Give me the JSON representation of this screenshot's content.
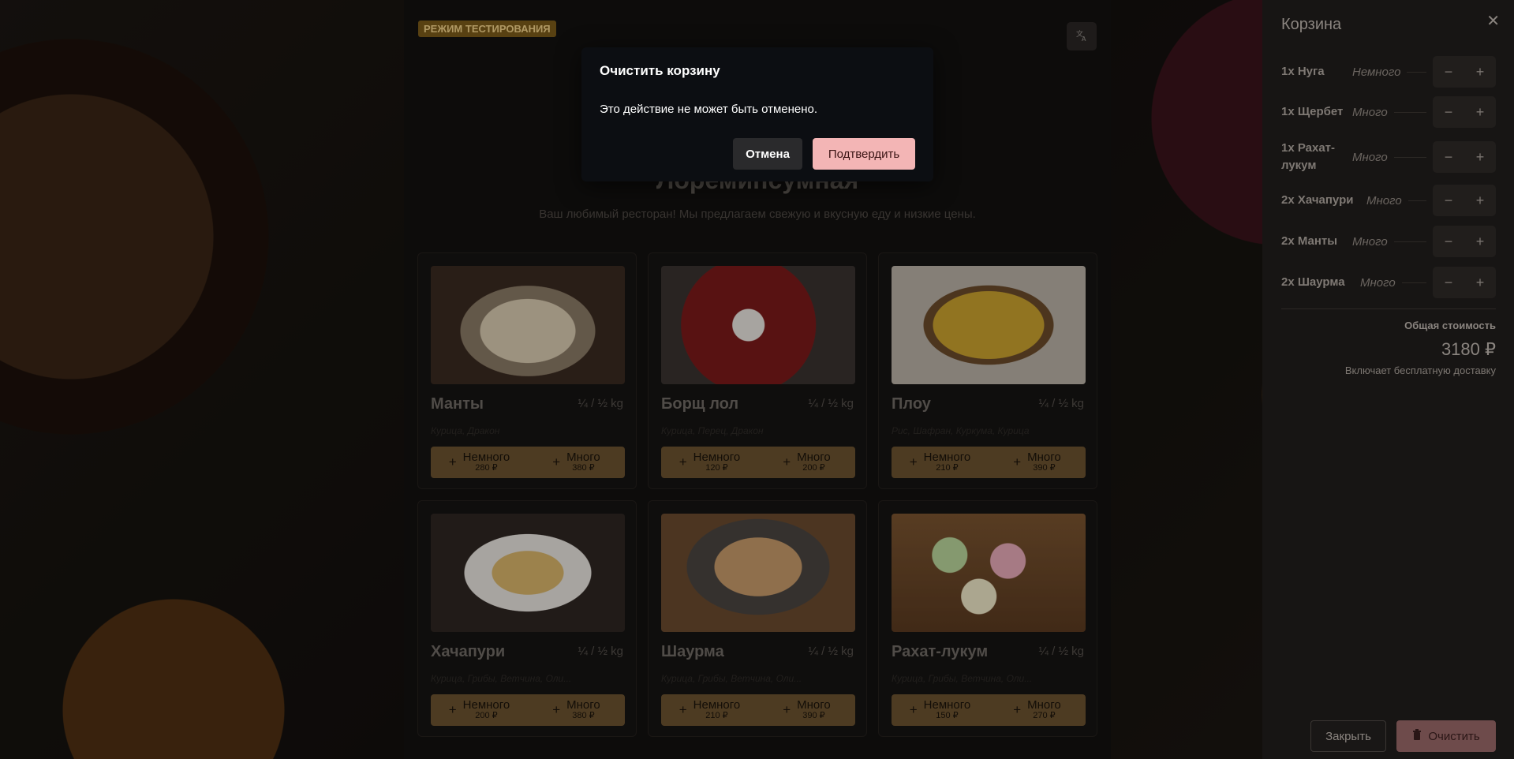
{
  "header": {
    "test_mode_badge": "РЕЖИМ ТЕСТИРОВАНИЯ",
    "lang_icon": "translate-icon",
    "title": "Лоремипсумная",
    "subtitle": "Ваш любимый ресторан! Мы предлагаем свежую и вкусную еду и низкие цены."
  },
  "menu": [
    {
      "name": "Манты",
      "weight": "¼ / ½ kg",
      "ingredients": "Курица, Дракон",
      "small_label": "Немного",
      "small_price": "280 ₽",
      "large_label": "Много",
      "large_price": "380 ₽"
    },
    {
      "name": "Борщ лол",
      "weight": "¼ / ½ kg",
      "ingredients": "Курица, Перец, Дракон",
      "small_label": "Немного",
      "small_price": "120 ₽",
      "large_label": "Много",
      "large_price": "200 ₽"
    },
    {
      "name": "Плоу",
      "weight": "¼ / ½ kg",
      "ingredients": "Рис, Шафран, Куркума, Курица",
      "small_label": "Немного",
      "small_price": "210 ₽",
      "large_label": "Много",
      "large_price": "390 ₽"
    },
    {
      "name": "Хачапури",
      "weight": "¼ / ½ kg",
      "ingredients": "Курица, Грибы, Ветчина, Оли...",
      "small_label": "Немного",
      "small_price": "200 ₽",
      "large_label": "Много",
      "large_price": "380 ₽"
    },
    {
      "name": "Шаурма",
      "weight": "¼ / ½ kg",
      "ingredients": "Курица, Грибы, Ветчина, Оли...",
      "small_label": "Немного",
      "small_price": "210 ₽",
      "large_label": "Много",
      "large_price": "390 ₽"
    },
    {
      "name": "Рахат-лукум",
      "weight": "¼ / ½ kg",
      "ingredients": "Курица, Грибы, Ветчина, Оли...",
      "small_label": "Немного",
      "small_price": "150 ₽",
      "large_label": "Много",
      "large_price": "270 ₽"
    }
  ],
  "dialog": {
    "title": "Очистить корзину",
    "message": "Это действие не может быть отменено.",
    "cancel_label": "Отмена",
    "confirm_label": "Подтвердить"
  },
  "cart": {
    "title": "Корзина",
    "close_icon": "close-icon",
    "items": [
      {
        "name": "1x Нуга",
        "size": "Немного"
      },
      {
        "name": "1x Щербет",
        "size": "Много"
      },
      {
        "name": "1x Рахат-лукум",
        "size": "Много"
      },
      {
        "name": "2x Хачапури",
        "size": "Много"
      },
      {
        "name": "2x Манты",
        "size": "Много"
      },
      {
        "name": "2x Шаурма",
        "size": "Много"
      }
    ],
    "minus_symbol": "−",
    "plus_symbol": "+",
    "total_label": "Общая стоимость",
    "total_value": "3180 ₽",
    "delivery_note": "Включает бесплатную доставку",
    "close_button": "Закрыть",
    "clear_button": "Очистить"
  },
  "colors": {
    "accent": "#6b5230",
    "confirm": "#f3b5b5",
    "badge": "#7a5a1a"
  }
}
